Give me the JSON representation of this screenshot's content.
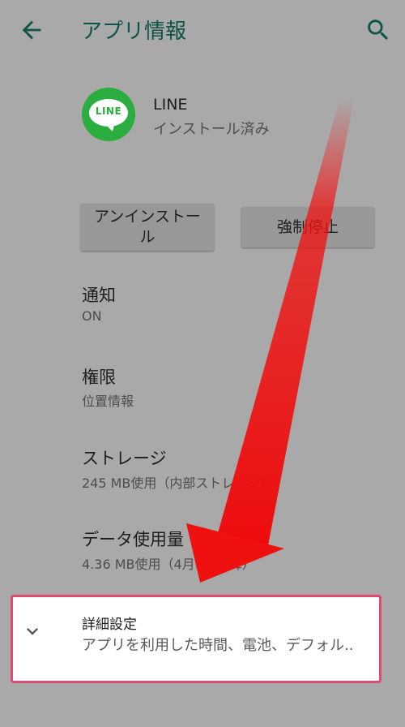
{
  "appbar": {
    "title": "アプリ情報",
    "back_icon": "arrow-back-icon",
    "search_icon": "search-icon"
  },
  "app": {
    "name": "LINE",
    "status": "インストール済み",
    "logo_text": "LINE",
    "logo_color": "#2bae3f"
  },
  "buttons": {
    "uninstall": "アンインストール",
    "force_stop": "強制停止"
  },
  "items": [
    {
      "title": "通知",
      "subtitle": "ON"
    },
    {
      "title": "権限",
      "subtitle": "位置情報"
    },
    {
      "title": "ストレージ",
      "subtitle": "245 MB使用（内部ストレージ）"
    },
    {
      "title": "データ使用量",
      "subtitle": "4.36 MB使用（4月1日以降）"
    }
  ],
  "advanced": {
    "title": "詳細設定",
    "subtitle": "アプリを利用した時間、電池、デフォル..",
    "icon": "chevron-down-icon"
  },
  "colors": {
    "accent": "#0f5248",
    "highlight_border": "#e14b73",
    "arrow": "#f01010"
  }
}
